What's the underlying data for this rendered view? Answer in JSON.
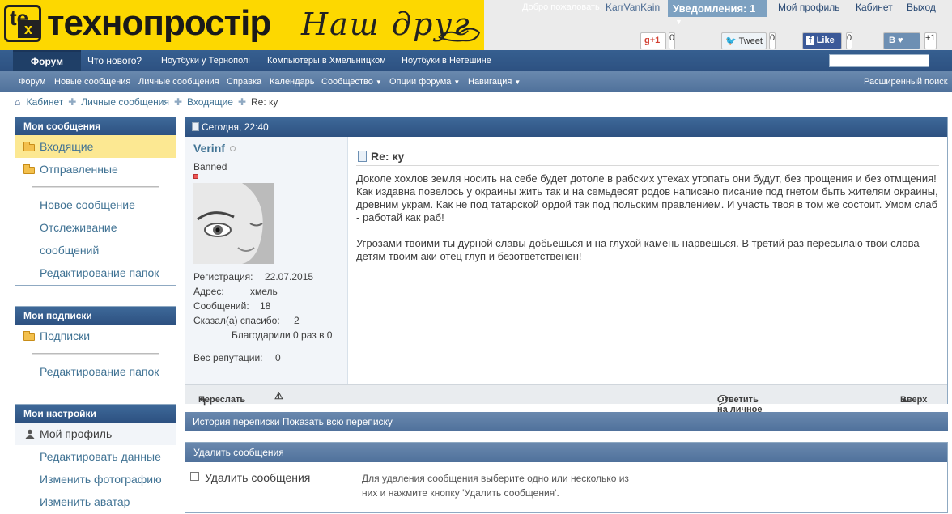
{
  "header": {
    "logo_text": "технопростір",
    "slogan": "Наш друг",
    "welcome": "Добро пожаловать,",
    "username": "KarrVanKain",
    "notifications_label": "Уведомления:",
    "notifications_count": "1",
    "my_profile": "Мой профиль",
    "cabinet": "Кабинет",
    "logout": "Выход"
  },
  "share": {
    "gplus_label": "+1",
    "gplus_count": "0",
    "tweet_label": "Tweet",
    "tweet_count": "0",
    "like_label": "Like",
    "like_count": "0",
    "vk_label": "B",
    "vk_count": "+1"
  },
  "nav": {
    "tabs": [
      "Форум",
      "Что нового?",
      "Ноутбуки у Тернополі",
      "Компьютеры в Хмельницком",
      "Ноутбуки в Нетешине"
    ],
    "sub": [
      "Форум",
      "Новые сообщения",
      "Личные сообщения",
      "Справка",
      "Календарь",
      "Сообщество",
      "Опции форума",
      "Навигация"
    ],
    "advanced_search": "Расширенный поиск"
  },
  "breadcrumb": [
    "Кабинет",
    "Личные сообщения",
    "Входящие",
    "Re: ку"
  ],
  "sidebar": {
    "messages": {
      "title": "Мои сообщения",
      "folders": [
        "Входящие",
        "Отправленные"
      ],
      "links": [
        "Новое сообщение",
        "Отслеживание",
        "сообщений",
        "Редактирование папок"
      ]
    },
    "subscriptions": {
      "title": "Мои подписки",
      "folders": [
        "Подписки"
      ],
      "links": [
        "Редактирование папок"
      ]
    },
    "settings": {
      "title": "Мои настройки",
      "links": [
        "Мой профиль",
        "Редактировать данные",
        "Изменить фотографию",
        "Изменить аватар"
      ]
    }
  },
  "message": {
    "date": "Сегодня, 22:40",
    "author": "Verinf",
    "rank": "Banned",
    "reg_label": "Регистрация:",
    "reg_value": "22.07.2015",
    "addr_label": "Адрес:",
    "addr_value": "хмель",
    "posts_label": "Сообщений:",
    "posts_value": "18",
    "thanks_label": "Сказал(а) спасибо:",
    "thanks_value": "2",
    "thanked": "Благодарили 0 раз в 0",
    "rep_label": "Вес репутации:",
    "rep_value": "0",
    "title": "Re: ку",
    "para1": "Доколе хохлов земля носить на себе будет дотоле в рабских утехах утопать они будут, без прощения и без отмщения! Как издавна повелось у окраины жить так и на семьдесят родов написано писание под гнетом быть жителям окраины, древним украм. Как не под татарской ордой так под польским правлением. И участь твоя в том же состоит. Умом слаб - работай как раб!",
    "para2": "Угрозами твоими ты дурной славы добьешься и на глухой камень нарвешься. В третий раз пересылаю твои слова детям твоим аки отец глуп и безответственен!",
    "forward": "Переслать",
    "reply": "Ответить на личное сообщение",
    "top": "Вверх"
  },
  "history": "История переписки Показать всю переписку",
  "delete": {
    "title": "Удалить сообщения",
    "checkbox_label": "Удалить сообщения",
    "help": "Для удаления сообщения выберите одно или несколько из них и нажмите кнопку 'Удалить сообщения'."
  }
}
